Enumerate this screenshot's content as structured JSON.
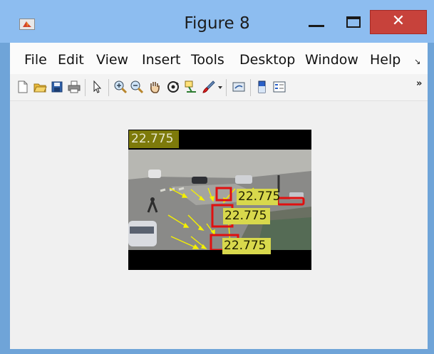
{
  "window": {
    "title": "Figure 8",
    "close_glyph": "✕",
    "icons": [
      "matlab-figure-icon",
      "minimize-icon",
      "maximize-icon",
      "close-icon"
    ]
  },
  "menu": {
    "items": [
      "File",
      "Edit",
      "View",
      "Insert",
      "Tools",
      "Desktop",
      "Window",
      "Help"
    ],
    "more_glyph": "↘"
  },
  "toolbar": {
    "icons": [
      "new-figure-icon",
      "open-file-icon",
      "save-icon",
      "print-icon",
      "select-arrow-icon",
      "zoom-in-icon",
      "zoom-out-icon",
      "pan-hand-icon",
      "rotate-3d-icon",
      "data-cursor-icon",
      "brush-icon",
      "brush-dropdown-icon",
      "link-plot-icon",
      "colorbar-icon",
      "legend-icon"
    ],
    "more_glyph": "»"
  },
  "figure": {
    "frame_time": "22.775",
    "track_labels": [
      "22.775",
      "22.775",
      "22.775"
    ],
    "arrow_color": "#f4f000",
    "box_color": "#e01010"
  }
}
